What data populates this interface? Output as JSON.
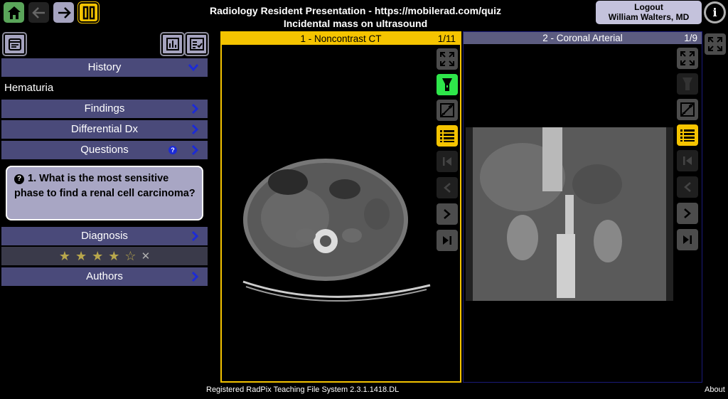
{
  "header": {
    "title": "Radiology Resident Presentation - https://mobilerad.com/quiz",
    "subtitle": "Incidental mass on ultrasound",
    "logout_label": "Logout",
    "user_name": "William Walters, MD",
    "info_glyph": "i"
  },
  "toolbar": {
    "home_icon": "home-icon",
    "back_icon": "arrow-left-icon",
    "forward_icon": "arrow-right-icon",
    "pause_icon": "pause-icon"
  },
  "sidebar": {
    "history_label": "History",
    "history_text": "Hematuria",
    "findings_label": "Findings",
    "differential_label": "Differential Dx",
    "questions_label": "Questions",
    "question_text": "1. What is the most sensitive phase to find a renal cell carcinoma?",
    "question_glyph": "?",
    "diagnosis_label": "Diagnosis",
    "rating": {
      "filled": 4,
      "max": 5,
      "clear_glyph": "✕"
    },
    "authors_label": "Authors"
  },
  "viewports": [
    {
      "title": "1 - Noncontrast CT",
      "counter": "1/11"
    },
    {
      "title": "2 - Coronal Arterial",
      "counter": "1/9"
    }
  ],
  "footer": {
    "system": "Registered RadPix Teaching File System 2.3.1.1418.DL",
    "about": "About"
  },
  "colors": {
    "accent_yellow": "#f5c400",
    "bar_blue": "#4a4a7a",
    "home_green": "#5aa55a",
    "active_green": "#2ee64a"
  }
}
